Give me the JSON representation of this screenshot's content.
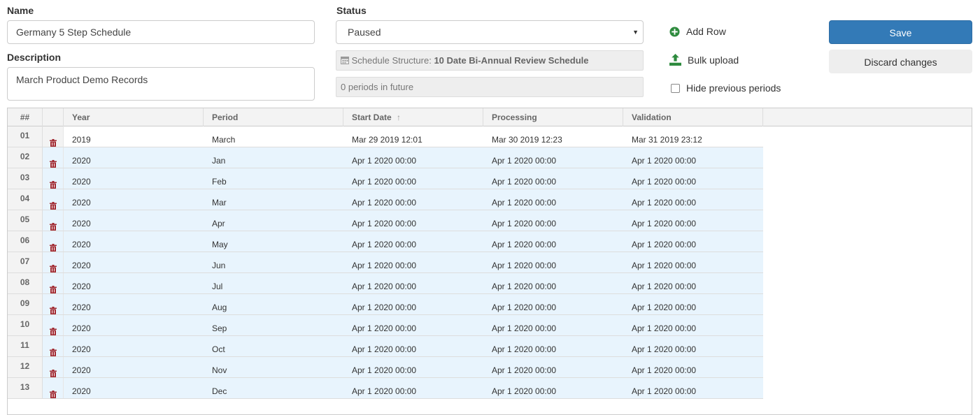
{
  "form": {
    "name_label": "Name",
    "name_value": "Germany 5 Step Schedule",
    "description_label": "Description",
    "description_value": "March Product Demo Records",
    "status_label": "Status",
    "status_value": "Paused",
    "structure_prefix": "Schedule Structure:",
    "structure_value": "10 Date Bi-Annual Review Schedule",
    "future_periods": "0 periods in future"
  },
  "actions": {
    "add_row": "Add Row",
    "bulk_upload": "Bulk upload",
    "hide_previous": "Hide previous periods",
    "save": "Save",
    "discard": "Discard changes"
  },
  "colors": {
    "primary": "#337ab7",
    "add_icon": "#2e8b3e",
    "trash_icon": "#a02830",
    "selected_row": "#e8f4fd"
  },
  "table": {
    "headers": {
      "num": "##",
      "year": "Year",
      "period": "Period",
      "start": "Start Date",
      "start_sort": "↑",
      "processing": "Processing",
      "validation": "Validation"
    },
    "rows": [
      {
        "num": "01",
        "year": "2019",
        "period": "March",
        "start": "Mar 29 2019 12:01",
        "processing": "Mar 30 2019 12:23",
        "validation": "Mar 31 2019 23:12"
      },
      {
        "num": "02",
        "year": "2020",
        "period": "Jan",
        "start": "Apr 1 2020 00:00",
        "processing": "Apr 1 2020 00:00",
        "validation": "Apr 1 2020 00:00"
      },
      {
        "num": "03",
        "year": "2020",
        "period": "Feb",
        "start": "Apr 1 2020 00:00",
        "processing": "Apr 1 2020 00:00",
        "validation": "Apr 1 2020 00:00"
      },
      {
        "num": "04",
        "year": "2020",
        "period": "Mar",
        "start": "Apr 1 2020 00:00",
        "processing": "Apr 1 2020 00:00",
        "validation": "Apr 1 2020 00:00"
      },
      {
        "num": "05",
        "year": "2020",
        "period": "Apr",
        "start": "Apr 1 2020 00:00",
        "processing": "Apr 1 2020 00:00",
        "validation": "Apr 1 2020 00:00"
      },
      {
        "num": "06",
        "year": "2020",
        "period": "May",
        "start": "Apr 1 2020 00:00",
        "processing": "Apr 1 2020 00:00",
        "validation": "Apr 1 2020 00:00"
      },
      {
        "num": "07",
        "year": "2020",
        "period": "Jun",
        "start": "Apr 1 2020 00:00",
        "processing": "Apr 1 2020 00:00",
        "validation": "Apr 1 2020 00:00"
      },
      {
        "num": "08",
        "year": "2020",
        "period": "Jul",
        "start": "Apr 1 2020 00:00",
        "processing": "Apr 1 2020 00:00",
        "validation": "Apr 1 2020 00:00"
      },
      {
        "num": "09",
        "year": "2020",
        "period": "Aug",
        "start": "Apr 1 2020 00:00",
        "processing": "Apr 1 2020 00:00",
        "validation": "Apr 1 2020 00:00"
      },
      {
        "num": "10",
        "year": "2020",
        "period": "Sep",
        "start": "Apr 1 2020 00:00",
        "processing": "Apr 1 2020 00:00",
        "validation": "Apr 1 2020 00:00"
      },
      {
        "num": "11",
        "year": "2020",
        "period": "Oct",
        "start": "Apr 1 2020 00:00",
        "processing": "Apr 1 2020 00:00",
        "validation": "Apr 1 2020 00:00"
      },
      {
        "num": "12",
        "year": "2020",
        "period": "Nov",
        "start": "Apr 1 2020 00:00",
        "processing": "Apr 1 2020 00:00",
        "validation": "Apr 1 2020 00:00"
      },
      {
        "num": "13",
        "year": "2020",
        "period": "Dec",
        "start": "Apr 1 2020 00:00",
        "processing": "Apr 1 2020 00:00",
        "validation": "Apr 1 2020 00:00"
      }
    ]
  }
}
